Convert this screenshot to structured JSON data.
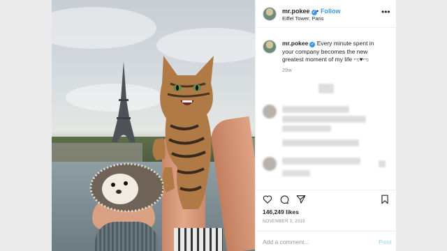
{
  "post": {
    "username": "mr.pokee",
    "follow_separator": "•",
    "follow_label": "Follow",
    "location": "Eiffel Tower, Paris",
    "more_label": "•••",
    "caption_text": " Every minute spent in your company becomes the new greatest moment of my life ",
    "caption_emoji": "ಌ♥ಌ",
    "age": "29w",
    "likes": "146,249 likes",
    "date": "NOVEMBER 3, 2019",
    "comment_placeholder": "Add a comment...",
    "post_label": "Post",
    "verified_glyph": "✓"
  },
  "colors": {
    "accent": "#3897f0",
    "post_disabled": "#b2dffc",
    "text": "#262626",
    "muted": "#8e8e8e"
  },
  "icons": [
    "heart-icon",
    "comment-icon",
    "share-icon",
    "bookmark-icon",
    "more-icon",
    "verified-icon"
  ]
}
